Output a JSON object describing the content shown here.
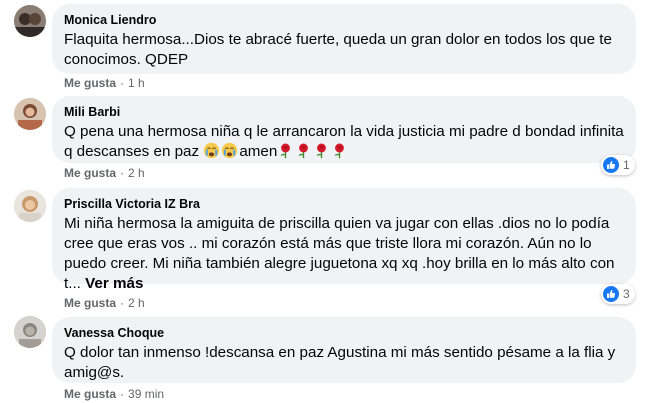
{
  "comments": [
    {
      "author": "Monica Liendro",
      "text": "Flaquita hermosa...Dios te abracé fuerte, queda un gran dolor en todos los que te conocimos. QDEP",
      "like_label": "Me gusta",
      "separator": "·",
      "time": "1 h"
    },
    {
      "author": "Mili Barbi",
      "text_line1": "Q pena una hermosa niña q le arrancaron la vida justicia mi padre d bondad infinita",
      "text_line2_pre": "q descanses en paz ",
      "text_line2_mid": "amen",
      "emoji_before": [
        "crying-face",
        "crying-face"
      ],
      "emoji_after": [
        "rose",
        "rose",
        "rose",
        "rose"
      ],
      "like_label": "Me gusta",
      "separator": "·",
      "time": "2 h",
      "reaction_count": "1"
    },
    {
      "author": "Priscilla Victoria IZ Bra",
      "text": "Mi niña hermosa la amiguita de priscilla quien va jugar con ellas .dios no lo podía cree que eras vos .. mi corazón está más que triste llora mi corazón. Aún no lo puedo creer. Mi niña también alegre juguetona xq xq .hoy brilla en lo más alto con t...",
      "see_more": "Ver más",
      "like_label": "Me gusta",
      "separator": "·",
      "time": "2 h",
      "reaction_count": "3"
    },
    {
      "author": "Vanessa Choque",
      "text": "Q dolor tan inmenso !descansa en paz Agustina mi más sentido pésame a la flia y amig@s.",
      "like_label": "Me gusta",
      "separator": "·",
      "time": "39 min"
    }
  ],
  "colors": {
    "bubble": "#f0f2f5",
    "meta": "#65676b",
    "like_blue": "#1877f2"
  }
}
